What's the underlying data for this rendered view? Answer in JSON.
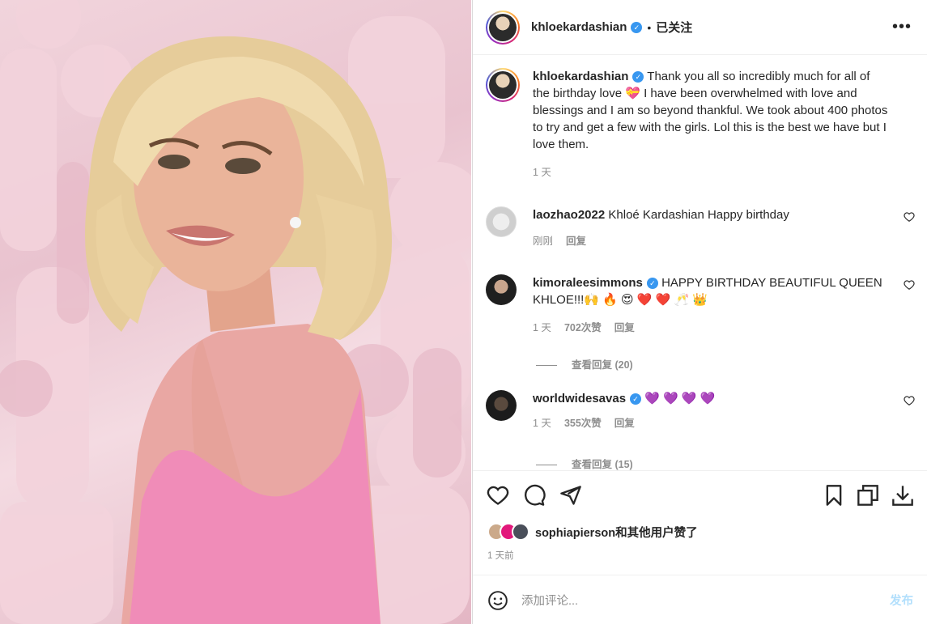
{
  "colors": {
    "accent": "#3897f0",
    "text": "#262626",
    "muted": "#8e8e8e",
    "post_disabled": "#b2dffc"
  },
  "photo": {
    "alt_icon": "photo"
  },
  "header": {
    "username": "khloekardashian",
    "verified_icon": "verified-badge-icon",
    "separator": "•",
    "follow_state": "已关注",
    "more": "•••"
  },
  "caption": {
    "username": "khloekardashian",
    "text": "Thank you all so incredibly much for all of the birthday love 💝 I have been overwhelmed with love and blessings and I am so beyond thankful. We took about 400 photos to try and get a few with the girls. Lol this is the best we have but I love them.",
    "time": "1 天"
  },
  "comments": [
    {
      "username": "laozhao2022",
      "verified": false,
      "text": "Khloé Kardashian Happy birthday",
      "time": "刚刚",
      "likes": "",
      "reply": "回复"
    },
    {
      "username": "kimoraleesimmons",
      "verified": true,
      "text": "HAPPY BIRTHDAY BEAUTIFUL QUEEN KHLOE!!!🙌 🔥 😍 ❤️ ❤️ 🥂 👑",
      "time": "1 天",
      "likes": "702次赞",
      "reply": "回复",
      "view_replies": "查看回复 (20)"
    },
    {
      "username": "worldwidesavas",
      "verified": true,
      "text": "💜 💜 💜 💜",
      "time": "1 天",
      "likes": "355次赞",
      "reply": "回复",
      "view_replies": "查看回复 (15)"
    }
  ],
  "actions": {
    "liked_by_user": "sophiapierson",
    "liked_by_suffix_1": "和",
    "liked_by_others": "其他用户",
    "liked_by_suffix_2": "赞了",
    "time_ago": "1 天前"
  },
  "add_comment": {
    "placeholder": "添加评论...",
    "post_label": "发布"
  }
}
